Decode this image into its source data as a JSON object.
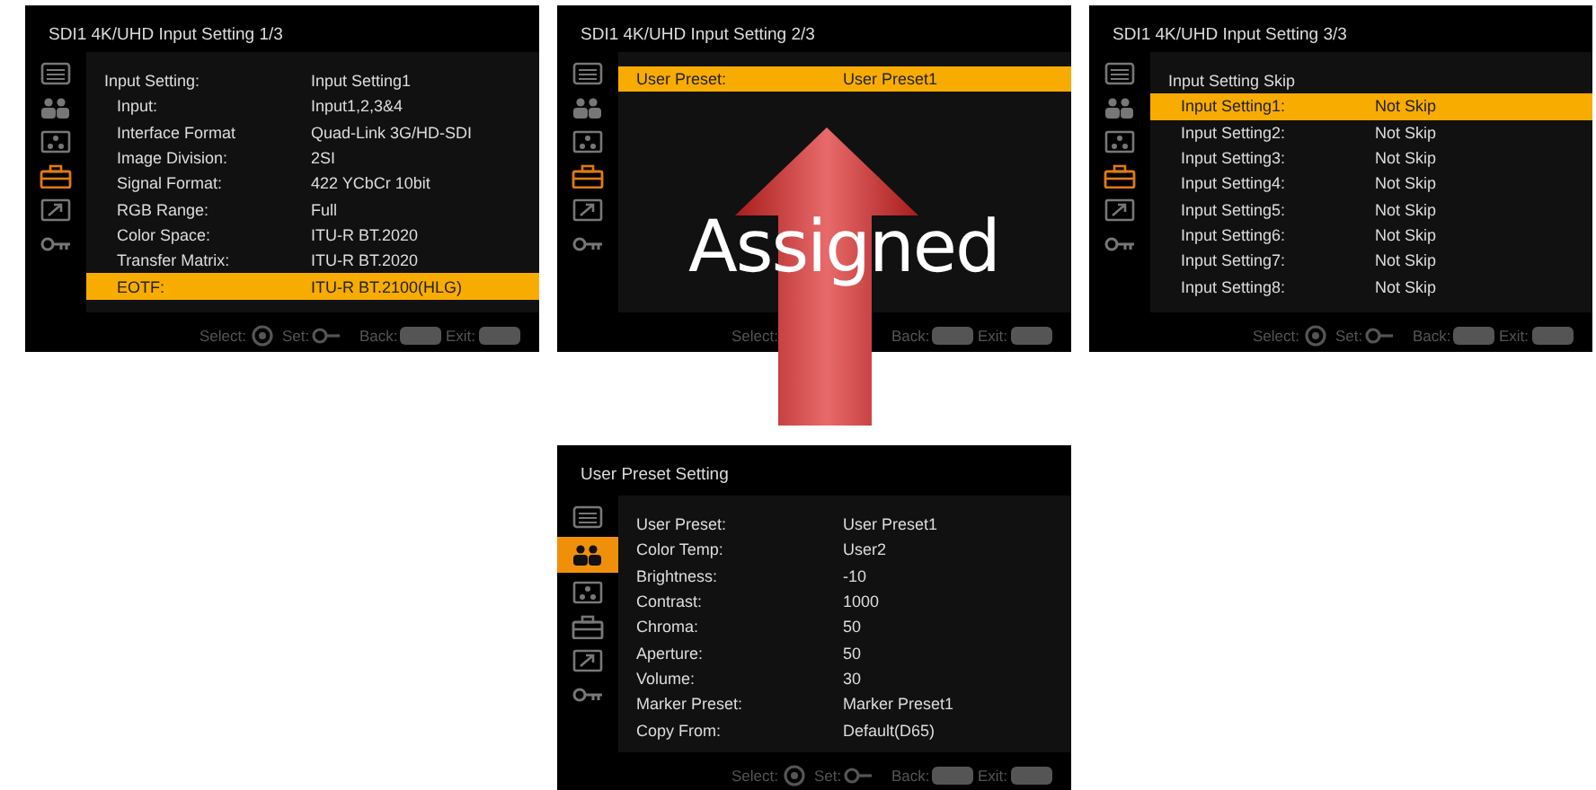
{
  "panels": [
    {
      "title": "SDI1 4K/UHD Input Setting 1/3",
      "sidebar": [
        {
          "kind": "list",
          "selected": false
        },
        {
          "kind": "people",
          "selected": false
        },
        {
          "kind": "network",
          "selected": false
        },
        {
          "kind": "toolbox",
          "selected": true
        },
        {
          "kind": "export",
          "selected": false
        },
        {
          "kind": "key",
          "selected": false
        }
      ],
      "kind": "sub",
      "rows": [
        {
          "label": "Input Setting:",
          "value": "Input Setting1",
          "selected": false,
          "children": [
            {
              "label": "Input:",
              "value": "Input1,2,3&4",
              "selected": false
            },
            {
              "label": "Interface Format",
              "value": "Quad-Link 3G/HD-SDI",
              "selected": false
            },
            {
              "label": "Image Division:",
              "value": "2SI",
              "selected": false
            },
            {
              "label": "Signal Format:",
              "value": "422 YCbCr 10bit",
              "selected": false
            },
            {
              "label": "RGB Range:",
              "value": "Full",
              "selected": false
            },
            {
              "label": "Color Space:",
              "value": "ITU-R BT.2020",
              "selected": false
            },
            {
              "label": "Transfer Matrix:",
              "value": "ITU-R BT.2020",
              "selected": false
            },
            {
              "label": "EOTF:",
              "value": "ITU-R BT.2100(HLG)",
              "selected": true
            }
          ]
        }
      ],
      "footer": [
        {
          "kind": "select",
          "label": "Select:"
        },
        {
          "kind": "set",
          "label": "Set:"
        },
        {
          "kind": "back",
          "label": "Back:"
        },
        {
          "kind": "exit",
          "label": "Exit:"
        }
      ]
    },
    {
      "title": "SDI1 4K/UHD Input Setting 2/3",
      "sidebar": [
        {
          "kind": "list",
          "selected": false
        },
        {
          "kind": "people",
          "selected": false
        },
        {
          "kind": "network",
          "selected": false
        },
        {
          "kind": "toolbox",
          "selected": true
        },
        {
          "kind": "export",
          "selected": false
        },
        {
          "kind": "key",
          "selected": false
        }
      ],
      "kind": "sub",
      "rows": [
        {
          "label": "User Preset:",
          "value": "User Preset1",
          "selected": true
        }
      ],
      "footer": [
        {
          "kind": "select_label",
          "label": "Select:"
        },
        {
          "kind": "back",
          "label": "Back:"
        },
        {
          "kind": "exit",
          "label": "Exit:"
        }
      ],
      "overlay": {
        "label": "Assigned"
      }
    },
    {
      "title": "SDI1 4K/UHD Input Setting 3/3",
      "sidebar": [
        {
          "kind": "list",
          "selected": false
        },
        {
          "kind": "people",
          "selected": false
        },
        {
          "kind": "network",
          "selected": false
        },
        {
          "kind": "toolbox",
          "selected": true
        },
        {
          "kind": "export",
          "selected": false
        },
        {
          "kind": "key",
          "selected": false
        }
      ],
      "kind": "sub",
      "rows": [
        {
          "label": "Input Setting Skip",
          "selected": false,
          "children": [
            {
              "label": "Input Setting1:",
              "value": "Not Skip",
              "selected": true
            },
            {
              "label": "Input Setting2:",
              "value": "Not Skip",
              "selected": false
            },
            {
              "label": "Input Setting3:",
              "value": "Not Skip",
              "selected": false
            },
            {
              "label": "Input Setting4:",
              "value": "Not Skip",
              "selected": false
            },
            {
              "label": "Input Setting5:",
              "value": "Not Skip",
              "selected": false
            },
            {
              "label": "Input Setting6:",
              "value": "Not Skip",
              "selected": false
            },
            {
              "label": "Input Setting7:",
              "value": "Not Skip",
              "selected": false
            },
            {
              "label": "Input Setting8:",
              "value": "Not Skip",
              "selected": false
            }
          ]
        }
      ],
      "footer": [
        {
          "kind": "select",
          "label": "Select:"
        },
        {
          "kind": "set",
          "label": "Set:"
        },
        {
          "kind": "back",
          "label": "Back:"
        },
        {
          "kind": "exit",
          "label": "Exit:"
        }
      ]
    },
    {
      "title": "User Preset Setting",
      "kind": "main",
      "sidebar": [
        {
          "kind": "list",
          "selected": false
        },
        {
          "kind": "people",
          "selected": true
        },
        {
          "kind": "network",
          "selected": false
        },
        {
          "kind": "toolbox",
          "selected": false
        },
        {
          "kind": "export",
          "selected": false
        },
        {
          "kind": "key",
          "selected": false
        }
      ],
      "rows": [
        {
          "label": "User Preset:",
          "value": "User Preset1",
          "selected": false
        },
        {
          "label": "Color Temp:",
          "value": "User2",
          "selected": false
        },
        {
          "label": "Brightness:",
          "value": "-10",
          "selected": false
        },
        {
          "label": "Contrast:",
          "value": "1000",
          "selected": false
        },
        {
          "label": "Chroma:",
          "value": "50",
          "selected": false
        },
        {
          "label": "Aperture:",
          "value": "50",
          "selected": false
        },
        {
          "label": "Volume:",
          "value": "30",
          "selected": false
        },
        {
          "label": "Marker Preset:",
          "value": "Marker Preset1",
          "selected": false
        },
        {
          "label": "Copy From:",
          "value": "Default(D65)",
          "selected": false
        }
      ],
      "footer": [
        {
          "kind": "select",
          "label": "Select:"
        },
        {
          "kind": "set",
          "label": "Set:"
        },
        {
          "kind": "back",
          "label": "Back:"
        },
        {
          "kind": "exit",
          "label": "Exit:"
        }
      ]
    }
  ]
}
